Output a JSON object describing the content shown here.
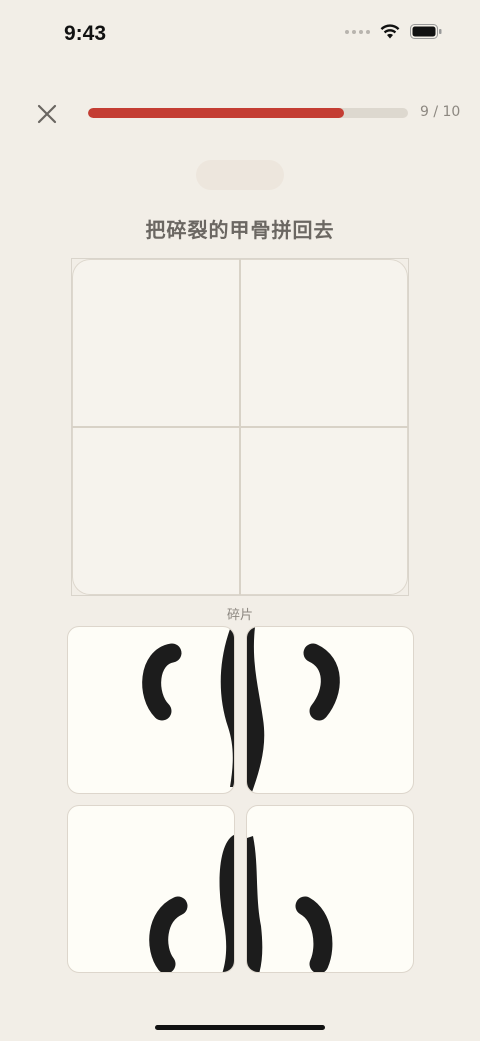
{
  "status_bar": {
    "time": "9:43"
  },
  "header": {
    "progress_text": "9 / 10",
    "progress_fraction": 0.8,
    "accent_color": "#c43d33",
    "close_icon": "close-icon"
  },
  "main": {
    "title": "把碎裂的甲骨拼回去",
    "pieces_label": "碎片"
  }
}
